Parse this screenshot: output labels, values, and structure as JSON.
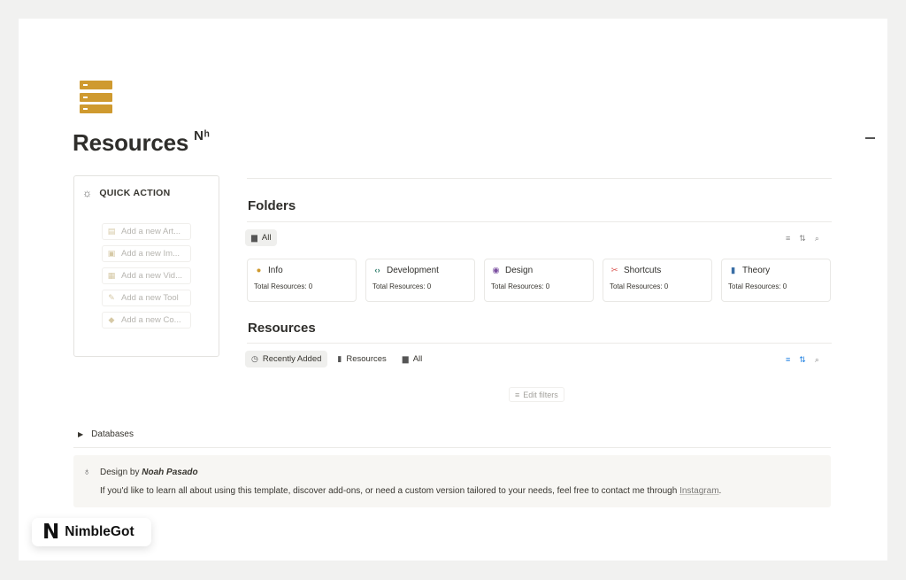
{
  "page": {
    "title": "Resources",
    "title_suffix": "Nʰ",
    "icon": "server-stack-icon",
    "accent_color": "#cf9a2f"
  },
  "quick_action": {
    "title": "QUICK ACTION",
    "icon": "cursor-click-icon",
    "items": [
      {
        "label": "Add a new Art...",
        "icon": "document-icon"
      },
      {
        "label": "Add a new Im...",
        "icon": "image-icon"
      },
      {
        "label": "Add a new Vid...",
        "icon": "film-icon"
      },
      {
        "label": "Add a new Tool",
        "icon": "wrench-icon"
      },
      {
        "label": "Add a new Co...",
        "icon": "graduation-cap-icon"
      }
    ]
  },
  "folders": {
    "title": "Folders",
    "tabs": [
      {
        "label": "All",
        "icon": "archive-icon",
        "active": true
      }
    ],
    "cards": [
      {
        "title": "Info",
        "icon": "info-icon",
        "icon_color": "#cf9a2f",
        "count_label": "Total Resources: 0"
      },
      {
        "title": "Development",
        "icon": "code-icon",
        "icon_color": "#2e7d6b",
        "count_label": "Total Resources: 0"
      },
      {
        "title": "Design",
        "icon": "palette-icon",
        "icon_color": "#7b4fa0",
        "count_label": "Total Resources: 0"
      },
      {
        "title": "Shortcuts",
        "icon": "scissors-icon",
        "icon_color": "#d9534f",
        "count_label": "Total Resources: 0"
      },
      {
        "title": "Theory",
        "icon": "book-icon",
        "icon_color": "#3a6ea5",
        "count_label": "Total Resources: 0"
      }
    ]
  },
  "resources": {
    "title": "Resources",
    "tabs": [
      {
        "label": "Recently Added",
        "icon": "clock-icon",
        "active": true
      },
      {
        "label": "Resources",
        "icon": "bookmark-icon",
        "active": false
      },
      {
        "label": "All",
        "icon": "archive-icon",
        "active": false
      }
    ],
    "edit_filters_label": "Edit filters"
  },
  "databases_toggle": "Databases",
  "callout": {
    "prefix": "Design by ",
    "author": "Noah Pasado",
    "message": "If you'd like to learn all about using this template, discover add-ons, or need a custom version tailored to your needs, feel free to contact me through ",
    "link_text": "Instagram",
    "suffix": "."
  },
  "brand": {
    "logo_letter": "N",
    "name": "NimbleGot"
  }
}
